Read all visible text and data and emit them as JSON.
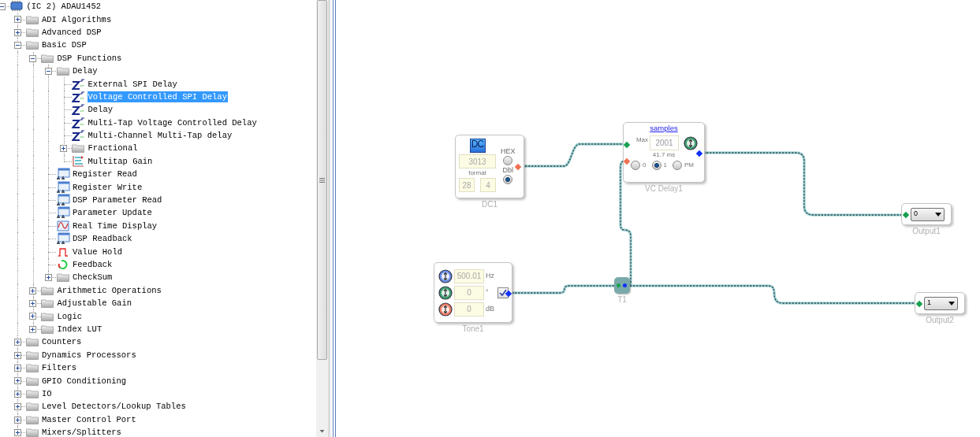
{
  "tree": [
    {
      "label": "(IC 2) ADAU1452",
      "kind": "chip",
      "expanded": true,
      "selected": false,
      "children": [
        {
          "label": "ADI Algorithms",
          "kind": "folder",
          "expanded": false,
          "selected": false
        },
        {
          "label": "Advanced DSP",
          "kind": "folder",
          "expanded": false,
          "selected": false
        },
        {
          "label": "Basic DSP",
          "kind": "folder",
          "expanded": true,
          "selected": false,
          "children": [
            {
              "label": "DSP Functions",
              "kind": "folder",
              "expanded": true,
              "selected": false,
              "children": [
                {
                  "label": "Delay",
                  "kind": "folder",
                  "expanded": true,
                  "selected": false,
                  "children": [
                    {
                      "label": "External SPI Delay",
                      "kind": "delay",
                      "selected": false
                    },
                    {
                      "label": "Voltage Controlled SPI Delay",
                      "kind": "delay",
                      "selected": true
                    },
                    {
                      "label": "Delay",
                      "kind": "delay",
                      "selected": false
                    },
                    {
                      "label": "Multi-Tap Voltage Controlled Delay",
                      "kind": "delay",
                      "selected": false
                    },
                    {
                      "label": "Multi-Channel Multi-Tap delay",
                      "kind": "delay",
                      "selected": false
                    },
                    {
                      "label": "Fractional",
                      "kind": "folder",
                      "expanded": false,
                      "selected": false
                    },
                    {
                      "label": "Multitap Gain",
                      "kind": "multitap",
                      "selected": false
                    }
                  ]
                },
                {
                  "label": "Register Read",
                  "kind": "register",
                  "selected": false
                },
                {
                  "label": "Register Write",
                  "kind": "register",
                  "selected": false
                },
                {
                  "label": "DSP Parameter Read",
                  "kind": "register",
                  "selected": false
                },
                {
                  "label": "Parameter Update",
                  "kind": "register",
                  "selected": false
                },
                {
                  "label": "Real Time Display",
                  "kind": "realtime",
                  "selected": false
                },
                {
                  "label": "DSP Readback",
                  "kind": "register",
                  "selected": false
                },
                {
                  "label": "Value Hold",
                  "kind": "hold",
                  "selected": false
                },
                {
                  "label": "Feedback",
                  "kind": "feedback",
                  "selected": false
                },
                {
                  "label": "CheckSum",
                  "kind": "folder",
                  "expanded": false,
                  "selected": false
                }
              ]
            },
            {
              "label": "Arithmetic Operations",
              "kind": "folder",
              "expanded": false,
              "selected": false
            },
            {
              "label": "Adjustable Gain",
              "kind": "folder",
              "expanded": false,
              "selected": false
            },
            {
              "label": "Logic",
              "kind": "folder",
              "expanded": false,
              "selected": false
            },
            {
              "label": "Index LUT",
              "kind": "folder",
              "expanded": false,
              "selected": false
            }
          ]
        },
        {
          "label": "Counters",
          "kind": "folder",
          "expanded": false,
          "selected": false
        },
        {
          "label": "Dynamics Processors",
          "kind": "folder",
          "expanded": false,
          "selected": false
        },
        {
          "label": "Filters",
          "kind": "folder",
          "expanded": false,
          "selected": false
        },
        {
          "label": "GPIO Conditioning",
          "kind": "folder",
          "expanded": false,
          "selected": false
        },
        {
          "label": "IO",
          "kind": "folder",
          "expanded": false,
          "selected": false
        },
        {
          "label": "Level Detectors/Lookup Tables",
          "kind": "folder",
          "expanded": false,
          "selected": false
        },
        {
          "label": "Master Control Port",
          "kind": "folder",
          "expanded": false,
          "selected": false
        },
        {
          "label": "Mixers/Splitters",
          "kind": "folder",
          "expanded": false,
          "selected": false
        }
      ]
    }
  ],
  "blocks": [
    {
      "kind": "dc",
      "label": "DC1",
      "icon_text": "DC",
      "value": "3013",
      "hex_label": "HEX",
      "hex_on": false,
      "format_label": "format",
      "format_fields": [
        "28",
        "4"
      ],
      "dbl_label": "Dbl",
      "dbl_on": true
    },
    {
      "kind": "delay",
      "label": "VC Delay1",
      "link": "samples",
      "max_label": "Max",
      "max_value": "2001",
      "time": "41.7 ms",
      "modes": [
        {
          "label": "0",
          "selected": false
        },
        {
          "label": "1",
          "selected": true
        },
        {
          "label": "PM",
          "selected": false
        }
      ]
    },
    {
      "kind": "tone",
      "label": "Tone1",
      "rows": [
        {
          "value": "500.01",
          "unit": "Hz",
          "color": "#6a8ee8"
        },
        {
          "value": "0",
          "unit": "°",
          "color": "#3fa070"
        },
        {
          "value": "0",
          "unit": "dB",
          "color": "#ee7e68"
        }
      ],
      "enabled": true
    },
    {
      "kind": "tee",
      "label": "T1"
    },
    {
      "kind": "output",
      "label": "Output1",
      "value": "0"
    },
    {
      "kind": "output",
      "label": "Output2",
      "value": "1"
    }
  ]
}
